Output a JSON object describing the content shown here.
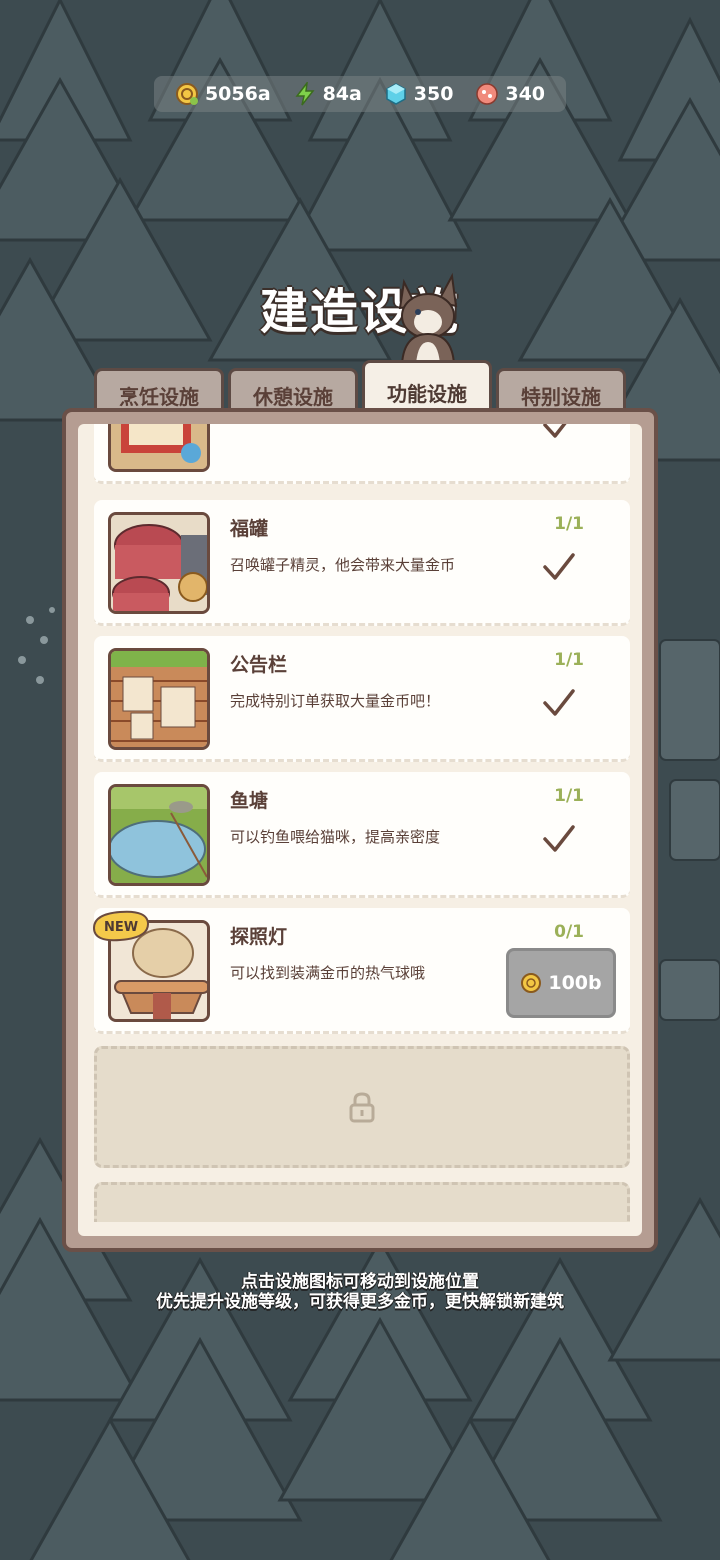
{
  "resources": [
    {
      "icon": "coin-icon",
      "value": "5056a"
    },
    {
      "icon": "energy-icon",
      "value": "84a"
    },
    {
      "icon": "gem-icon",
      "value": "350"
    },
    {
      "icon": "fish-cookie-icon",
      "value": "340"
    }
  ],
  "title": "建造设施",
  "tabs": [
    {
      "label": "烹饪设施",
      "active": false
    },
    {
      "label": "休憩设施",
      "active": false
    },
    {
      "label": "功能设施",
      "active": true
    },
    {
      "label": "特别设施",
      "active": false
    }
  ],
  "facilities": [
    {
      "name": "福罐",
      "desc": "召唤罐子精灵，他会带来大量金币",
      "count": "1/1",
      "built": true
    },
    {
      "name": "公告栏",
      "desc": "完成特别订单获取大量金币吧！",
      "count": "1/1",
      "built": true
    },
    {
      "name": "鱼塘",
      "desc": "可以钓鱼喂给猫咪，提高亲密度",
      "count": "1/1",
      "built": true
    },
    {
      "name": "探照灯",
      "desc": "可以找到装满金币的热气球哦",
      "count": "0/1",
      "built": false,
      "price": "100b",
      "badge": "NEW"
    }
  ],
  "hint": {
    "line1": "点击设施图标可移动到设施位置",
    "line2": "优先提升设施等级，可获得更多金币，更快解锁新建筑"
  },
  "colors": {
    "count_color": "#9bb058",
    "text_brown": "#5a4038",
    "panel_bg": "#f6efe4"
  }
}
